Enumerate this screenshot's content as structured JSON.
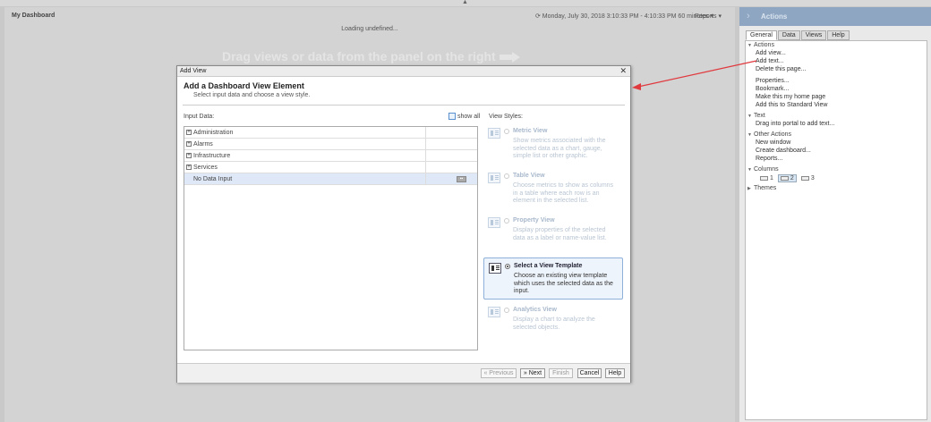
{
  "dashboard": {
    "title": "My Dashboard",
    "time_range": "⟳ Monday, July 30, 2018 3:10:33 PM - 4:10:33 PM 60 minutes  ▾",
    "reports": "Reports  ▾",
    "loading": "Loading undefined...",
    "drag_hint": "Drag views or data from the panel on the right"
  },
  "actions_panel": {
    "title": "Actions",
    "tabs": [
      "General",
      "Data",
      "Views",
      "Help"
    ],
    "sections": {
      "actions": {
        "label": "Actions",
        "items": [
          "Add view...",
          "Add text...",
          "Delete this page...",
          "Properties...",
          "Bookmark...",
          "Make this my home page",
          "Add this to Standard View"
        ]
      },
      "text": {
        "label": "Text",
        "items": [
          "Drag into portal to add text..."
        ]
      },
      "other": {
        "label": "Other Actions",
        "items": [
          "New window",
          "Create dashboard...",
          "Reports..."
        ]
      },
      "columns": {
        "label": "Columns",
        "options": [
          "1",
          "2",
          "3"
        ],
        "selected": "2"
      },
      "themes": {
        "label": "Themes"
      }
    }
  },
  "dialog": {
    "window_title": "Add View",
    "heading": "Add a Dashboard View Element",
    "subheading": "Select input data and choose a view style.",
    "input_label": "Input Data:",
    "show_all": "show all",
    "tree": [
      "Administration",
      "Alarms",
      "Infrastructure",
      "Services",
      "No Data Input"
    ],
    "selected_row": "No Data Input",
    "view_styles_label": "View Styles:",
    "view_styles": [
      {
        "title": "Metric View",
        "desc": "Show metrics associated with the selected data as a chart, gauge, simple list or other graphic."
      },
      {
        "title": "Table View",
        "desc": "Choose metrics to show as columns in a table where each row is an element in the selected list."
      },
      {
        "title": "Property View",
        "desc": "Display properties of the selected data as a label or name-value list."
      },
      {
        "title": "Select a View Template",
        "desc": "Choose an existing view template which uses the selected data as the input."
      },
      {
        "title": "Analytics View",
        "desc": "Display a chart to analyze the selected objects."
      }
    ],
    "selected_style": "Select a View Template",
    "buttons": {
      "previous": "« Previous",
      "next": "» Next",
      "finish": "Finish",
      "cancel": "Cancel",
      "help": "Help"
    }
  },
  "colors": {
    "annotation_arrow": "#e0393e",
    "actions_header": "#8fa6c2",
    "selection": "#dfe8f6"
  }
}
